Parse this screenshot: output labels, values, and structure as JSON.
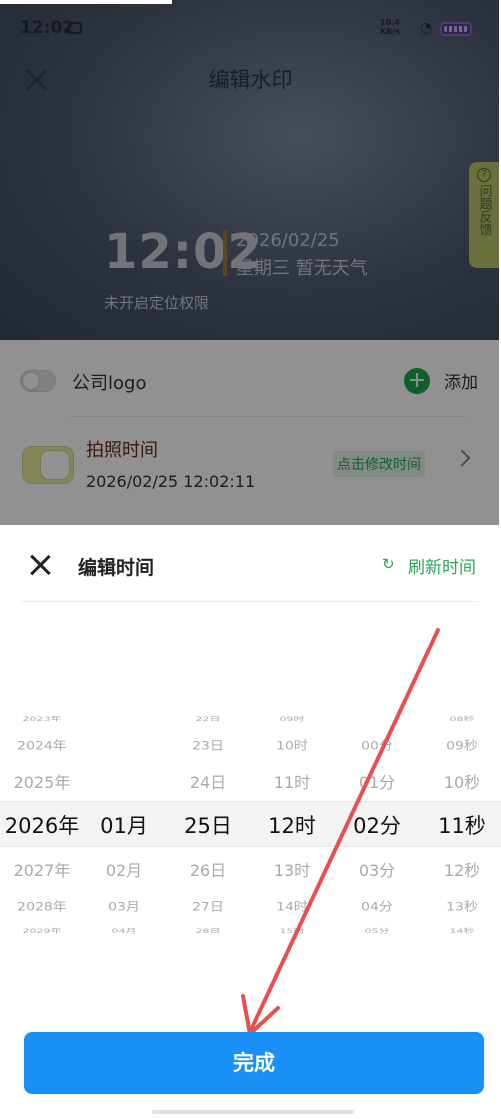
{
  "status_bar": {
    "time": "12:02",
    "net_speed_top": "10.4",
    "net_speed_bottom": "KB/s",
    "wifi_icon": "wifi-icon",
    "battery_icon": "battery-icon"
  },
  "header": {
    "title": "编辑水印"
  },
  "preview": {
    "time": "12:02",
    "date": "2026/02/25",
    "weekday_weather": "星期三 暂无天气",
    "location": "未开启定位权限",
    "accent_color": "#a47a35"
  },
  "feedback": {
    "icon": "?",
    "label": "问题反馈"
  },
  "settings": {
    "logo_row": {
      "label": "公司logo",
      "enabled": false,
      "add_label": "添加"
    },
    "photo_time_row": {
      "title": "拍照时间",
      "value": "2026/02/25 12:02:11",
      "edit_tag": "点击修改时间",
      "enabled": true
    }
  },
  "sheet": {
    "title": "编辑时间",
    "refresh_label": "刷新时间",
    "refresh_icon": "↻",
    "done_label": "完成",
    "accent_color": "#1890f8"
  },
  "picker": {
    "years": [
      "2023年",
      "2024年",
      "2025年",
      "2026年",
      "2027年",
      "2028年",
      "2029年"
    ],
    "months": [
      "",
      "",
      "",
      "01月",
      "02月",
      "03月",
      "04月"
    ],
    "days": [
      "22日",
      "23日",
      "24日",
      "25日",
      "26日",
      "27日",
      "28日"
    ],
    "hours": [
      "09时",
      "10时",
      "11时",
      "12时",
      "13时",
      "14时",
      "15时"
    ],
    "minutes": [
      "",
      "00分",
      "01分",
      "02分",
      "03分",
      "04分",
      "05分"
    ],
    "seconds": [
      "08秒",
      "09秒",
      "10秒",
      "11秒",
      "12秒",
      "13秒",
      "14秒"
    ],
    "selected_index": 3
  }
}
